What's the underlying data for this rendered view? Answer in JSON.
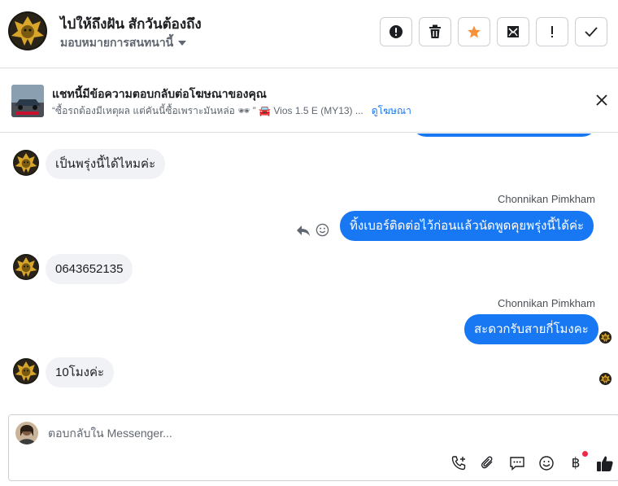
{
  "header": {
    "title": "ไปให้ถึงฝัน สักวันต้องถึง",
    "assign_label": "มอบหมายการสนทนานี้",
    "actions": [
      {
        "name": "report-spam-button",
        "icon": "alert-circle-icon"
      },
      {
        "name": "delete-button",
        "icon": "trash-icon"
      },
      {
        "name": "star-button",
        "icon": "star-icon"
      },
      {
        "name": "mark-unread-button",
        "icon": "envelope-icon"
      },
      {
        "name": "follow-up-button",
        "icon": "exclamation-icon"
      },
      {
        "name": "mark-done-button",
        "icon": "check-icon"
      }
    ],
    "colors": {
      "star": "#f7923b"
    }
  },
  "ad": {
    "title": "แชทนี้มีข้อความตอบกลับต่อโฆษณาของคุณ",
    "quote": "“ซื้อรถต้องมีเหตุผล แต่คันนี้ซื้อเพราะมันหล่อ 🕶 ” 🚘 Vios 1.5 E (MY13) ...",
    "link": "ดูโฆษณา"
  },
  "messages": [
    {
      "direction": "in",
      "text": "เป็นพรุ่งนี้ได้ไหมค่ะ"
    },
    {
      "direction": "out",
      "sender": "Chonnikan Pimkham",
      "text": "ทิ้งเบอร์ติดต่อไว้ก่อนแล้วนัดพูดคุยพรุ่งนี้ได้ค่ะ"
    },
    {
      "direction": "in",
      "text": "0643652135"
    },
    {
      "direction": "out",
      "sender": "Chonnikan Pimkham",
      "text": "สะดวกรับสายกี่โมงคะ"
    },
    {
      "direction": "in",
      "text": "10โมงค่ะ"
    }
  ],
  "composer": {
    "placeholder": "ตอบกลับใน Messenger...",
    "tools": [
      "call-add-icon",
      "paperclip-icon",
      "saved-reply-icon",
      "emoji-icon",
      "baht-icon",
      "thumbs-up-icon"
    ],
    "baht_symbol": "฿"
  },
  "colors": {
    "accent": "#1877f2",
    "incoming": "#f0f2f5",
    "notify": "#f02849"
  }
}
